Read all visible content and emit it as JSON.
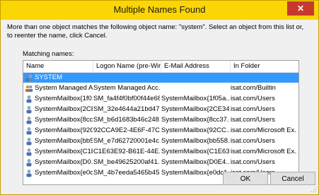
{
  "dialog": {
    "title": "Multiple Names Found",
    "close_label": "✕",
    "message": "More than one object matches the following object name: \"system\". Select an object from this list or, to reenter the name, click Cancel.",
    "matching_label": "Matching names:"
  },
  "columns": [
    "Name",
    "Logon Name (pre-Win...",
    "E-Mail Address",
    "In Folder"
  ],
  "rows": [
    {
      "icon": "group-icon",
      "cells": [
        "SYSTEM",
        "",
        "",
        ""
      ],
      "selected": true
    },
    {
      "icon": "user-group-icon",
      "cells": [
        "System Managed A...",
        "System Managed Acc...",
        "",
        "isat.com/Builtin"
      ],
      "selected": false
    },
    {
      "icon": "user-icon",
      "cells": [
        "SystemMailbox{1f0...",
        "SM_fa4f4f0bf00f44e68",
        "SystemMailbox{1f05a...",
        "isat.com/Users"
      ],
      "selected": false
    },
    {
      "icon": "user-icon",
      "cells": [
        "SystemMailbox{2CE...",
        "SM_32e4644a21bd47...",
        "SystemMailbox{2CE34...",
        "isat.com/Users"
      ],
      "selected": false
    },
    {
      "icon": "user-icon",
      "cells": [
        "SystemMailbox{8cc...",
        "SM_b6d1683b46c248...",
        "SystemMailbox{8cc37...",
        "isat.com/Users"
      ],
      "selected": false
    },
    {
      "icon": "user-icon",
      "cells": [
        "SystemMailbox{92C...",
        "92CCA9E2-4E6F-47C...",
        "SystemMailbox{92CC...",
        "isat.com/Microsoft Ex..."
      ],
      "selected": false
    },
    {
      "icon": "user-icon",
      "cells": [
        "SystemMailbox{bb5...",
        "SM_e7d62720001e4c...",
        "SystemMailbox{bb558...",
        "isat.com/Users"
      ],
      "selected": false
    },
    {
      "icon": "user-icon",
      "cells": [
        "SystemMailbox{C1E...",
        "C1E63E92-B61E-44E...",
        "SystemMailbox{C1E63...",
        "isat.com/Microsoft Ex..."
      ],
      "selected": false
    },
    {
      "icon": "user-icon",
      "cells": [
        "SystemMailbox{D0...",
        "SM_be49625200af41...",
        "SystemMailbox{D0E4...",
        "isat.com/Users"
      ],
      "selected": false
    },
    {
      "icon": "user-icon",
      "cells": [
        "SystemMailbox{e0d...",
        "SM_4b7eeda5465b45...",
        "SystemMailbox{e0dc1...",
        "isat.com/Users"
      ],
      "selected": false
    }
  ],
  "buttons": {
    "ok": "OK",
    "cancel": "Cancel"
  },
  "colors": {
    "titlebar": "#fbd604",
    "selection": "#3399ff",
    "close": "#c7392d"
  }
}
